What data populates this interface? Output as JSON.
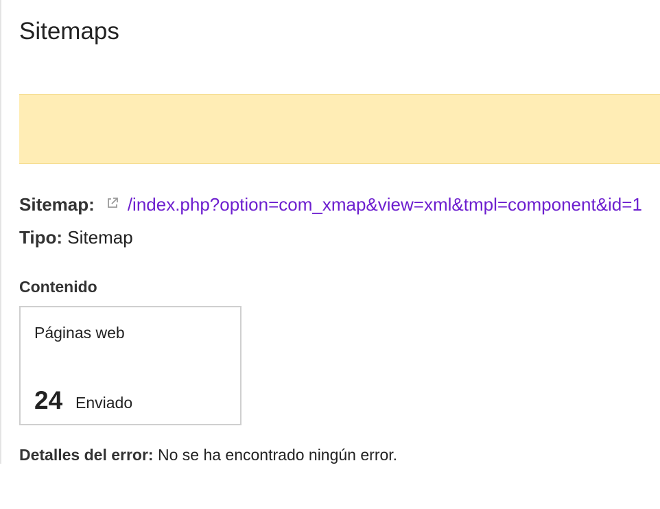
{
  "page": {
    "title": "Sitemaps"
  },
  "notice": {
    "text": ""
  },
  "details": {
    "sitemap_label": "Sitemap:",
    "sitemap_url": "/index.php?option=com_xmap&view=xml&tmpl=component&id=1",
    "type_label": "Tipo:",
    "type_value": "Sitemap"
  },
  "content": {
    "heading": "Contenido",
    "card": {
      "label": "Páginas web",
      "count": "24",
      "status": "Enviado"
    }
  },
  "errors": {
    "label": "Detalles del error:",
    "value": "No se ha encontrado ningún error."
  },
  "colors": {
    "link": "#6d1fcf",
    "notice_background": "#ffedb5",
    "card_border": "#cfcfcf"
  },
  "icons": {
    "sitemap_link_icon": "external-link-icon"
  }
}
